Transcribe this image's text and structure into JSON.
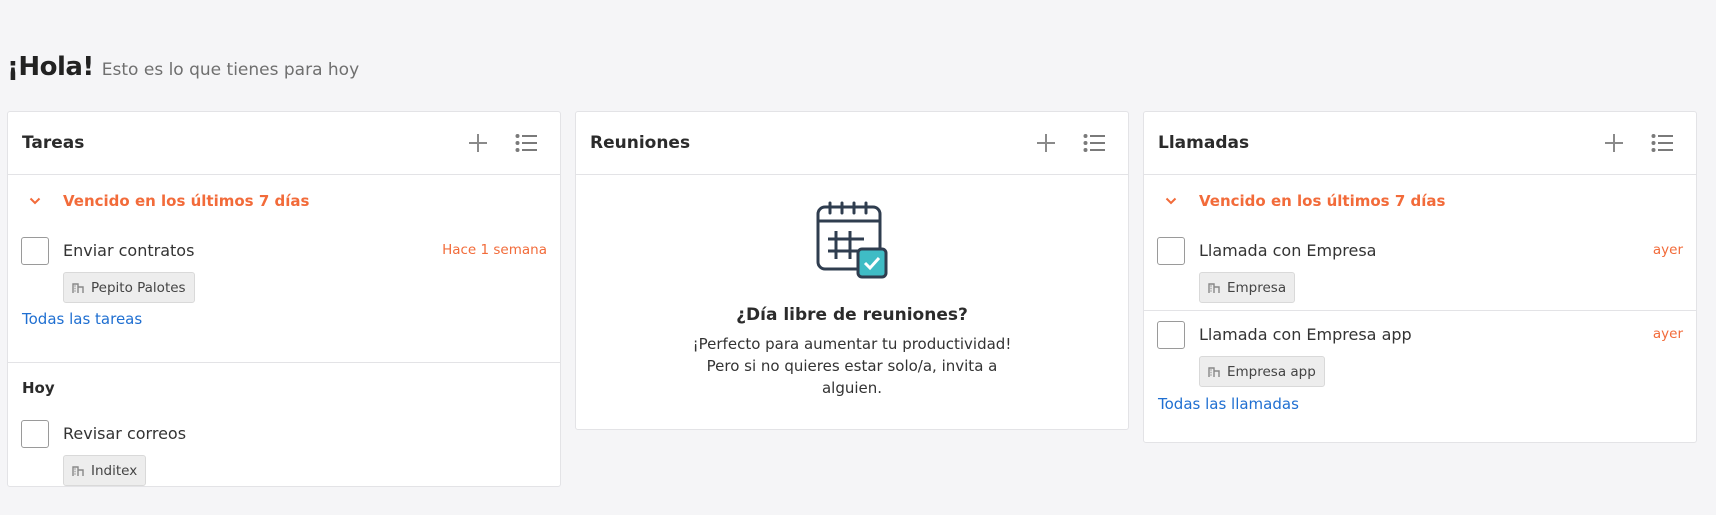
{
  "greeting": {
    "title": "¡Hola!",
    "subtitle": "Esto es lo que tienes para hoy"
  },
  "icons": {
    "add": "plus-icon",
    "list": "list-icon",
    "chevron": "chevron-down-icon",
    "company": "building-icon",
    "calendar": "calendar-check-icon"
  },
  "colors": {
    "overdue": "#f26b3a",
    "link": "#1f6fd1",
    "calendar_accent": "#3fbcc5"
  },
  "tasks": {
    "title": "Tareas",
    "overdue_label": "Vencido en los últimos 7 días",
    "overdue_items": [
      {
        "title": "Enviar contratos",
        "when": "Hace 1 semana",
        "tag": "Pepito Palotes"
      }
    ],
    "all_link": "Todas las tareas",
    "today_label": "Hoy",
    "today_items": [
      {
        "title": "Revisar correos",
        "tag": "Inditex"
      }
    ]
  },
  "meetings": {
    "title": "Reuniones",
    "empty_title": "¿Día libre de reuniones?",
    "empty_text": "¡Perfecto para aumentar tu productividad! Pero si no quieres estar solo/a, invita a alguien."
  },
  "calls": {
    "title": "Llamadas",
    "overdue_label": "Vencido en los últimos 7 días",
    "items": [
      {
        "title": "Llamada con Empresa",
        "when": "ayer",
        "tag": "Empresa"
      },
      {
        "title": "Llamada con Empresa app",
        "when": "ayer",
        "tag": "Empresa app"
      }
    ],
    "all_link": "Todas las llamadas"
  }
}
